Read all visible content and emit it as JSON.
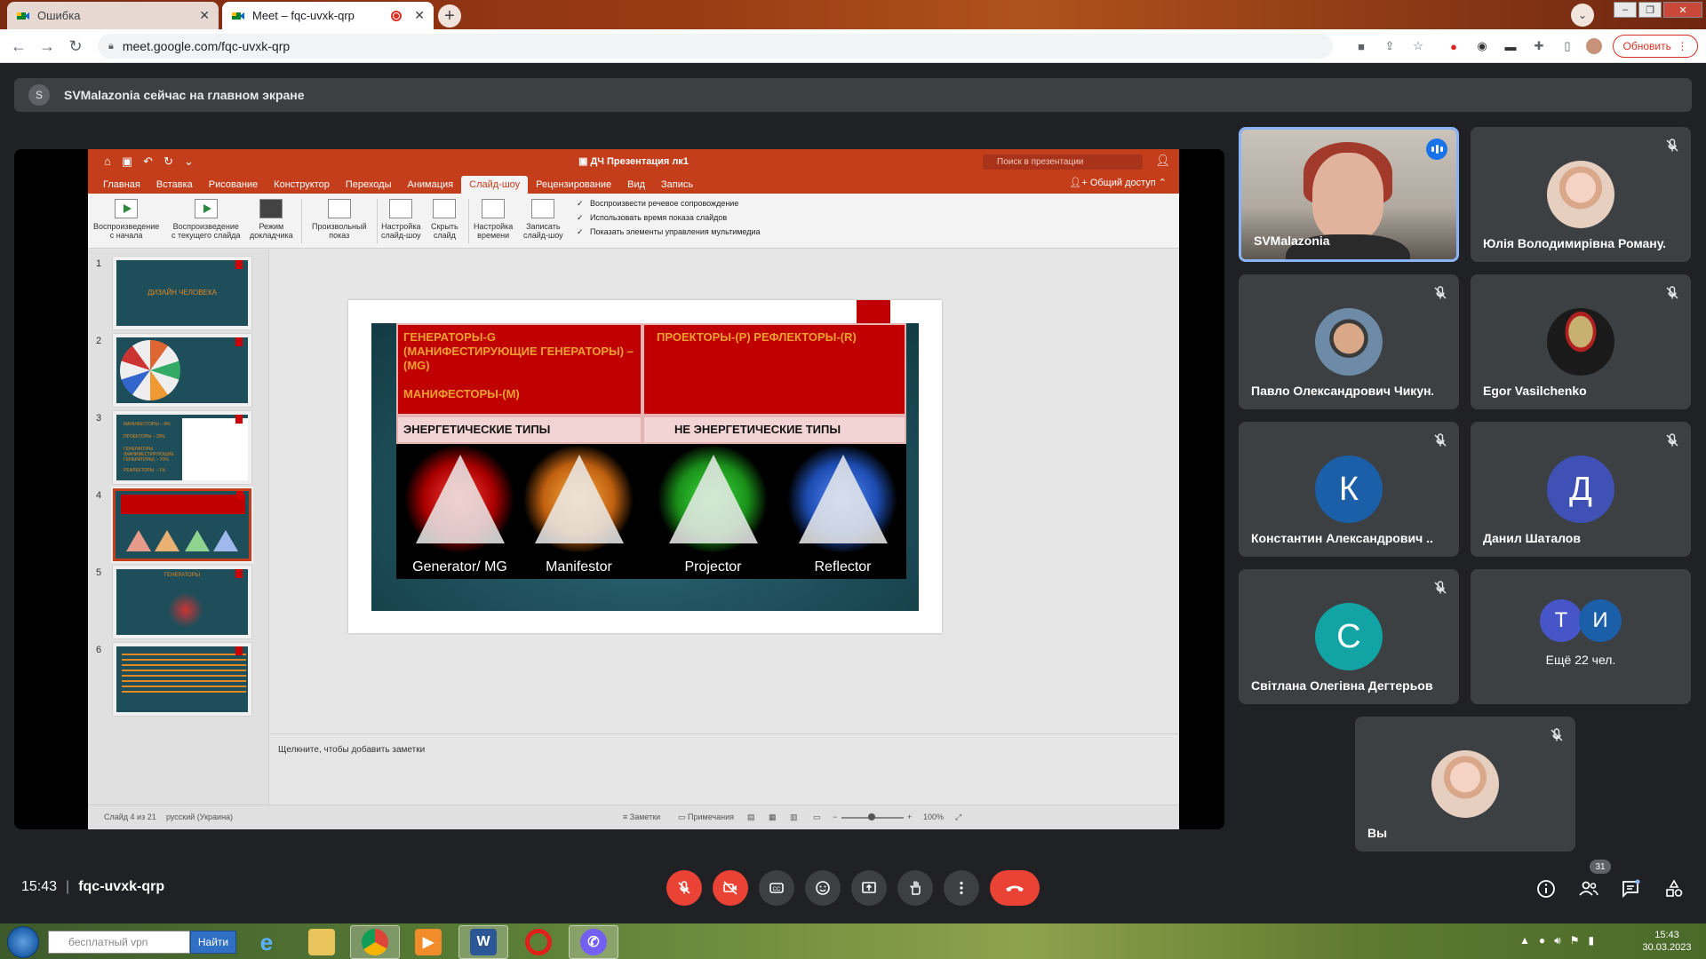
{
  "browser": {
    "tabs": [
      {
        "title": "Ошибка",
        "active": false
      },
      {
        "title": "Meet – fqc-uvxk-qrp",
        "active": true,
        "recording": true
      }
    ],
    "new_tab_label": "+",
    "url": "meet.google.com/fqc-uvxk-qrp",
    "update_label": "Обновить"
  },
  "meet": {
    "banner_initial": "S",
    "banner_text": "SVMalazonia сейчас на главном экране",
    "clock": "15:43",
    "meeting_code": "fqc-uvxk-qrp",
    "participants_count": "31",
    "participants": [
      {
        "name": "SVMalazonia",
        "type": "video",
        "speaking": true
      },
      {
        "name": "Юлія Володимирівна Роману...",
        "type": "photo",
        "muted": true
      },
      {
        "name": "Павло Олександрович Чикун...",
        "type": "photo",
        "muted": true
      },
      {
        "name": "Egor Vasilchenko",
        "type": "photo",
        "muted": true
      },
      {
        "name": "Константин Александрович ...",
        "type": "initial",
        "initial": "К",
        "color": "#1a5fa8",
        "muted": true
      },
      {
        "name": "Данил Шаталов",
        "type": "initial",
        "initial": "Д",
        "color": "#3f51b5",
        "muted": true
      },
      {
        "name": "Світлана Олегівна Дегтерьова",
        "type": "initial",
        "initial": "С",
        "color": "#12a4a4",
        "muted": true
      },
      {
        "name": "Ещё 22 чел.",
        "type": "more",
        "initials": [
          "Т",
          "И"
        ],
        "colors": [
          "#4656c8",
          "#1a5fa8"
        ]
      },
      {
        "name": "Вы",
        "type": "photo",
        "muted": true
      }
    ]
  },
  "ppt": {
    "doc_title": "ДЧ Презентация лк1",
    "search_placeholder": "Поиск в презентации",
    "ribbon_tabs": [
      "Главная",
      "Вставка",
      "Рисование",
      "Конструктор",
      "Переходы",
      "Анимация",
      "Слайд-шоу",
      "Рецензирование",
      "Вид",
      "Запись"
    ],
    "active_tab": "Слайд-шоу",
    "share_label": "Общий доступ",
    "ribbon_buttons": [
      {
        "label1": "Воспроизведение",
        "label2": "с начала"
      },
      {
        "label1": "Воспроизведение",
        "label2": "с текущего слайда"
      },
      {
        "label1": "Режим",
        "label2": "докладчика"
      },
      {
        "label1": "Произвольный",
        "label2": "показ"
      },
      {
        "label1": "Настройка",
        "label2": "слайд-шоу"
      },
      {
        "label1": "Скрыть",
        "label2": "слайд"
      },
      {
        "label1": "Настройка",
        "label2": "времени"
      },
      {
        "label1": "Записать",
        "label2": "слайд-шоу"
      }
    ],
    "checkboxes": [
      "Воспроизвести речевое сопровождение",
      "Использовать время показа слайдов",
      "Показать элементы управления мультимедиа"
    ],
    "thumbnails": [
      "1",
      "2",
      "3",
      "4",
      "5",
      "6"
    ],
    "thumb1_title": "ДИЗАЙН ЧЕЛОВЕКА",
    "thumb3_lines": [
      "МАНИФЕСТОРЫ – 9%",
      "ПРОЕКТОРЫ – 20%",
      "ГЕНЕРАТОРЫ (МАНИФЕСТИРУЮЩИЕ ГЕНЕРАТОРЫ) – 70%",
      "РЕФЛЕКТОРЫ – 1%"
    ],
    "thumb5_title": "ГЕНЕРАТОРЫ",
    "selected_thumb": 4,
    "slide": {
      "left_header_line1": "ГЕНЕРАТОРЫ-G",
      "left_header_line2": "(МАНИФЕСТИРУЮЩИЕ ГЕНЕРАТОРЫ) –",
      "left_header_line3": "(MG)",
      "left_header_line4": "МАНИФЕСТОРЫ-(М)",
      "right_header": "ПРОЕКТОРЫ-(Р)  РЕФЛЕКТОРЫ-(R)",
      "left_type": "ЭНЕРГЕТИЧЕСКИЕ ТИПЫ",
      "right_type": "НЕ ЭНЕРГЕТИЧЕСКИЕ ТИПЫ",
      "images": [
        {
          "label": "Generator/ MG",
          "glow": "#d32020"
        },
        {
          "label": "Manifestor",
          "glow": "#e07a10"
        },
        {
          "label": "Projector",
          "glow": "#22b022"
        },
        {
          "label": "Reflector",
          "glow": "#2a5fd6"
        }
      ]
    },
    "notes_placeholder": "Щелкните, чтобы добавить заметки",
    "status_slide": "Слайд 4 из 21",
    "status_lang": "русский (Украина)",
    "status_notes": "Заметки",
    "status_comments": "Примечания",
    "zoom": "100%"
  },
  "taskbar": {
    "search_placeholder": "бесплатный vpn",
    "search_button": "Найти",
    "time": "15:43",
    "date": "30.03.2023"
  }
}
